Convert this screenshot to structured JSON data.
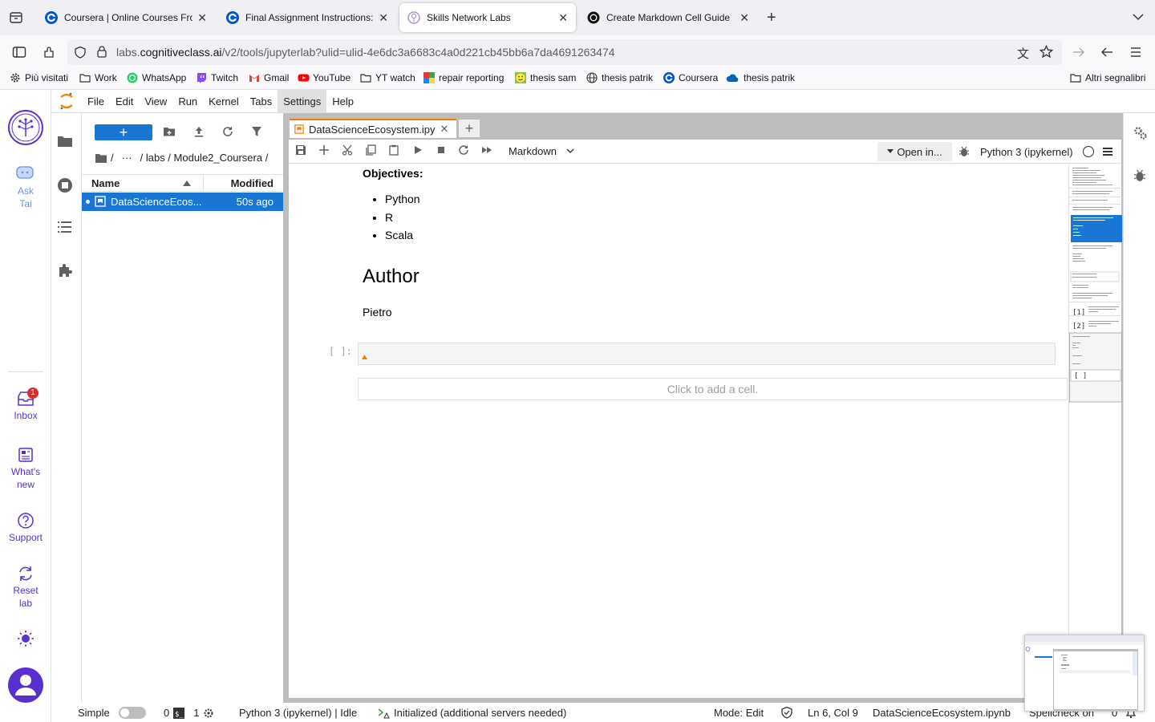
{
  "browser": {
    "tabs": [
      {
        "title": "Coursera | Online Courses From",
        "icon": "coursera-icon"
      },
      {
        "title": "Final Assignment Instructions: C",
        "icon": "coursera-icon"
      },
      {
        "title": "Skills Network Labs",
        "icon": "skills-network-icon",
        "active": true
      },
      {
        "title": "Create Markdown Cell Guide",
        "icon": "chatgpt-icon"
      }
    ],
    "url_prefix": "labs.",
    "url_domain": "cognitiveclass.ai",
    "url_path": "/v2/tools/jupyterlab?ulid=ulid-4e6dc3a6683c4a0d221cb45bb6a7da4691263474",
    "bookmarks": [
      {
        "label": "Più visitati",
        "icon": "gear-icon"
      },
      {
        "label": "Work",
        "icon": "folder-icon"
      },
      {
        "label": "WhatsApp",
        "icon": "whatsapp-icon"
      },
      {
        "label": "Twitch",
        "icon": "twitch-icon"
      },
      {
        "label": "Gmail",
        "icon": "gmail-icon"
      },
      {
        "label": "YouTube",
        "icon": "youtube-icon"
      },
      {
        "label": "YT watch",
        "icon": "folder-icon"
      },
      {
        "label": "repair reporting",
        "icon": "app-icon"
      },
      {
        "label": "thesis sam",
        "icon": "smiley-icon"
      },
      {
        "label": "thesis patrik",
        "icon": "globe-icon"
      },
      {
        "label": "Coursera",
        "icon": "coursera-icon"
      },
      {
        "label": "thesis patrik",
        "icon": "cloud-icon"
      }
    ],
    "other_bookmarks": "Altri segnalibri"
  },
  "rail": {
    "ask": "Ask",
    "ask2": "Tai",
    "inbox": "Inbox",
    "inbox_count": "1",
    "whatsnew": "What's",
    "whatsnew2": "new",
    "support": "Support",
    "reset": "Reset",
    "reset2": "lab"
  },
  "menubar": [
    "File",
    "Edit",
    "View",
    "Run",
    "Kernel",
    "Tabs",
    "Settings",
    "Help"
  ],
  "filebrowser": {
    "new_label": "+",
    "breadcrumb_root": "/",
    "breadcrumb_ellipsis": "···",
    "breadcrumb_path": "/ labs / Module2_Coursera /",
    "col_name": "Name",
    "col_modified": "Modified",
    "file_name": "DataScienceEcos...",
    "file_modified": "50s ago"
  },
  "notebook": {
    "tab_title": "DataScienceEcosystem.ipy",
    "cell_type": "Markdown",
    "open_in": "Open in...",
    "kernel": "Python 3 (ipykernel)",
    "objectives_label": "Objectives:",
    "objectives": [
      "Python",
      "R",
      "Scala"
    ],
    "author_heading": "Author",
    "author_name": "Pietro",
    "prompt": "[ ]:",
    "add_cell": "Click to add a cell."
  },
  "statusbar": {
    "mode": "Simple",
    "terminals": "0",
    "kernels": "1",
    "kernel_status": "Python 3 (ipykernel) | Idle",
    "lsp": "Initialized (additional servers needed)",
    "edit_mode": "Mode: Edit",
    "cursor": "Ln 6, Col 9",
    "filename": "DataScienceEcosystem.ipynb",
    "spellcheck": "Spellcheck on",
    "notifications": "0"
  },
  "colors": {
    "brand_purple": "#5a2fd2",
    "jupyter_blue": "#1976d2",
    "jupyter_orange": "#f57c00"
  }
}
